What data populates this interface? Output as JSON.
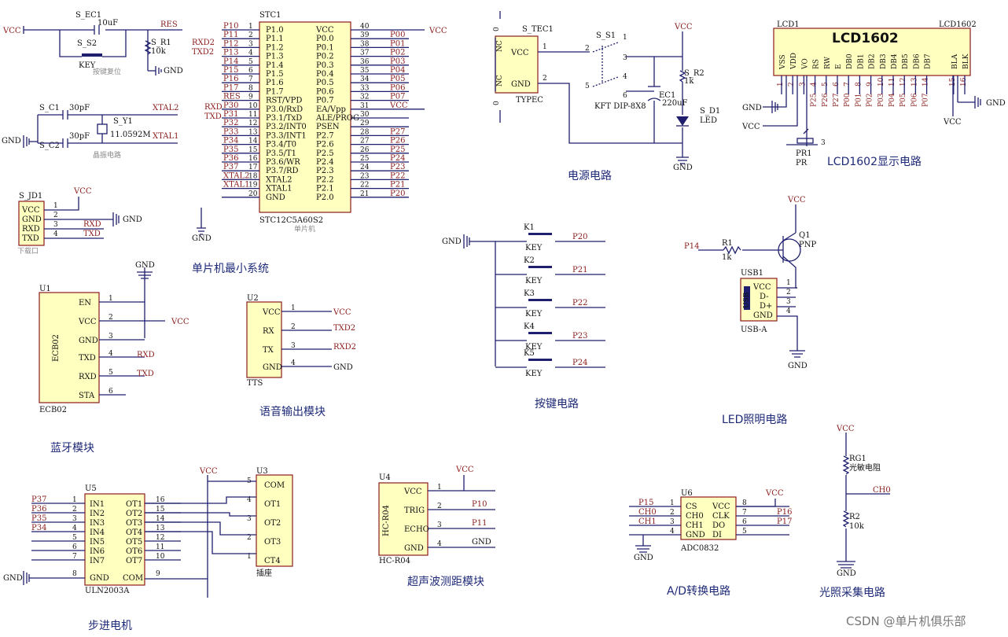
{
  "captions": {
    "mcu": "单片机最小系统",
    "power": "电源电路",
    "lcd": "LCD1602显示电路",
    "keys": "按键电路",
    "led": "LED照明电路",
    "bt": "蓝牙模块",
    "voice": "语音输出模块",
    "stepper": "步进电机",
    "ultra": "超声波测距模块",
    "adc": "A/D转换电路",
    "light": "光照采集电路"
  },
  "watermark": "CSDN @单片机俱乐部",
  "nets": {
    "vcc": "VCC",
    "gnd": "GND",
    "res": "RES",
    "xtal1": "XTAL1",
    "xtal2": "XTAL2",
    "txd": "TXD",
    "rxd": "RXD",
    "txd2": "TXD2",
    "rxd2": "RXD2",
    "ch0": "CH0",
    "ch1": "CH1",
    "p14": "P14",
    "p15": "P15",
    "p16": "P16",
    "p17": "P17",
    "p10": "P10",
    "p11": "P11"
  },
  "reset": {
    "cap": "S_EC1",
    "cap_val": "10uF",
    "sw": "S_S2",
    "sw_val": "KEY",
    "note": "按键复位",
    "res": "S_R1",
    "res_val": "10k"
  },
  "crystal": {
    "c1": "S_C1",
    "c2": "S_C2",
    "cval": "30pF",
    "y": "S_Y1",
    "yval": "11.0592M",
    "note": "晶振电路"
  },
  "jd": {
    "ref": "S_JD1",
    "pins": [
      "VCC",
      "GND",
      "RXD",
      "TXD"
    ],
    "nums": [
      "1",
      "2",
      "3",
      "4"
    ],
    "note": "下载口"
  },
  "mcu": {
    "ref": "STC1",
    "part": "STC12C5A60S2",
    "note": "单片机",
    "left": [
      [
        "P10",
        "1",
        "P1.0"
      ],
      [
        "P11",
        "2",
        "P1.1"
      ],
      [
        "P12",
        "3",
        "P1.2"
      ],
      [
        "P13",
        "4",
        "P1.3"
      ],
      [
        "P14",
        "5",
        "P1.4"
      ],
      [
        "P15",
        "6",
        "P1.5"
      ],
      [
        "P16",
        "7",
        "P1.6"
      ],
      [
        "P17",
        "8",
        "P1.7"
      ],
      [
        "RES",
        "9",
        "RST/VPD"
      ],
      [
        "P30",
        "10",
        "P3.0/RxD"
      ],
      [
        "P31",
        "11",
        "P3.1/TxD"
      ],
      [
        "P32",
        "12",
        "P3.2/INT0"
      ],
      [
        "P33",
        "13",
        "P3.3/INT1"
      ],
      [
        "P34",
        "14",
        "P3.4/T0"
      ],
      [
        "P35",
        "15",
        "P3.5/T1"
      ],
      [
        "P36",
        "16",
        "P3.6/WR"
      ],
      [
        "P37",
        "17",
        "P3.7/RD"
      ],
      [
        "XTAL2",
        "18",
        "XTAL2"
      ],
      [
        "XTAL1",
        "19",
        "XTAL1"
      ],
      [
        "",
        "20",
        "GND"
      ]
    ],
    "right": [
      [
        "VCC",
        "40",
        ""
      ],
      [
        "P0.0",
        "39",
        "P00"
      ],
      [
        "P0.1",
        "38",
        "P01"
      ],
      [
        "P0.2",
        "37",
        "P02"
      ],
      [
        "P0.3",
        "36",
        "P03"
      ],
      [
        "P0.4",
        "35",
        "P04"
      ],
      [
        "P0.5",
        "34",
        "P05"
      ],
      [
        "P0.6",
        "33",
        "P06"
      ],
      [
        "P0.7",
        "32",
        "P07"
      ],
      [
        "EA/Vpp",
        "31",
        "VCC"
      ],
      [
        "ALE/PROG",
        "30",
        ""
      ],
      [
        "PSEN",
        "29",
        ""
      ],
      [
        "P2.7",
        "28",
        "P27"
      ],
      [
        "P2.6",
        "27",
        "P26"
      ],
      [
        "P2.5",
        "26",
        "P25"
      ],
      [
        "P2.4",
        "25",
        "P24"
      ],
      [
        "P2.3",
        "24",
        "P23"
      ],
      [
        "P2.2",
        "23",
        "P22"
      ],
      [
        "P2.1",
        "22",
        "P21"
      ],
      [
        "P2.0",
        "21",
        "P20"
      ]
    ],
    "alias_rxd2": "RXD2",
    "alias_txd2": "TXD2",
    "alias_rxd": "RXD",
    "alias_txd": "TXD"
  },
  "power": {
    "tec": "S_TEC1",
    "tec_type": "TYPEC",
    "tec_pins": [
      "VCC",
      "GND"
    ],
    "tec_nc": "NC",
    "tec_nums": [
      "1",
      "2"
    ],
    "zero": "0",
    "sw": "S_S1",
    "sw_part": "KFT DIP-8X8",
    "sw_nums": [
      "1",
      "2",
      "3",
      "4",
      "5",
      "6"
    ],
    "ec": "EC1",
    "ec_val": "220uF",
    "r": "S_R2",
    "r_val": "1k",
    "d": "S_D1",
    "d_val": "LED"
  },
  "lcd": {
    "ref": "LCD1",
    "name": "LCD1602",
    "ref2": "LCD1602",
    "pins": [
      "VSS",
      "VDD",
      "VO",
      "RS",
      "RW",
      "E",
      "DB0",
      "DB1",
      "DB2",
      "DB3",
      "DB4",
      "DB5",
      "DB6",
      "DB7",
      "BLA",
      "BLK"
    ],
    "nums": [
      "1",
      "2",
      "3",
      "4",
      "5",
      "6",
      "7",
      "8",
      "9",
      "10",
      "11",
      "12",
      "13",
      "14",
      "15",
      "16"
    ],
    "nets": [
      "",
      "",
      "",
      "P25",
      "P26",
      "P27",
      "P00",
      "P01",
      "P02",
      "P03",
      "P04",
      "P05",
      "P06",
      "P07",
      "",
      ""
    ],
    "pr": "PR1",
    "pr_val": "PR",
    "pr_num": "3"
  },
  "keys": [
    {
      "ref": "K1",
      "net": "P20"
    },
    {
      "ref": "K2",
      "net": "P21"
    },
    {
      "ref": "K3",
      "net": "P22"
    },
    {
      "ref": "K4",
      "net": "P23"
    },
    {
      "ref": "K5",
      "net": "P24"
    }
  ],
  "key_val": "KEY",
  "led": {
    "q": "Q1",
    "q_val": "PNP",
    "r": "R1",
    "r_val": "1k",
    "usb": "USB1",
    "usb_type": "USB-A",
    "usb_pins": [
      "VCC",
      "D-",
      "D+",
      "GND"
    ],
    "usb_nums": [
      "1",
      "2",
      "3",
      "4"
    ],
    "usb_icon": "USB"
  },
  "bt": {
    "ref": "U1",
    "part": "ECB02",
    "pins": [
      "EN",
      "VCC",
      "GND",
      "TXD",
      "RXD",
      "STA"
    ],
    "nums": [
      "1",
      "2",
      "3",
      "4",
      "5",
      "6"
    ]
  },
  "voice": {
    "ref": "U2",
    "part": "TTS",
    "pins": [
      "VCC",
      "RX",
      "TX",
      "GND"
    ],
    "nums": [
      "1",
      "2",
      "3",
      "4"
    ]
  },
  "stepper": {
    "u5": "U5",
    "u5_part": "ULN2003A",
    "in": [
      "IN1",
      "IN2",
      "IN3",
      "IN4",
      "IN5",
      "IN6",
      "IN7"
    ],
    "in_nums": [
      "1",
      "2",
      "3",
      "4",
      "5",
      "6",
      "7"
    ],
    "out": [
      "OT1",
      "OT2",
      "OT3",
      "OT4",
      "OT5",
      "OT6",
      "OT7"
    ],
    "out_nums": [
      "16",
      "15",
      "14",
      "13",
      "12",
      "11",
      "10"
    ],
    "in_nets": [
      "P37",
      "P36",
      "P35",
      "P34"
    ],
    "gnd_pin": "GND",
    "gnd_num": "8",
    "com_pin": "COM",
    "com_num": "9",
    "u3": "U3",
    "u3_part": "插座",
    "u3_pins": [
      "COM",
      "OT1",
      "OT2",
      "OT3",
      "CT4"
    ],
    "u3_nums": [
      "5",
      "4",
      "3",
      "2",
      "1"
    ]
  },
  "ultra": {
    "ref": "U4",
    "part": "HC-R04",
    "pins": [
      "VCC",
      "TRIG",
      "ECHO",
      "GND"
    ],
    "nums": [
      "1",
      "2",
      "3",
      "4"
    ]
  },
  "adc": {
    "ref": "U6",
    "part": "ADC0832",
    "left": [
      "CS",
      "CH0",
      "CH1",
      "GND"
    ],
    "lnums": [
      "1",
      "2",
      "3",
      "4"
    ],
    "right": [
      "VCC",
      "CLK",
      "DO",
      "DI"
    ],
    "rnums": [
      "8",
      "7",
      "6",
      "5"
    ]
  },
  "light": {
    "rg": "RG1",
    "rg_val": "光敏电阻",
    "r": "R2",
    "r_val": "10k"
  }
}
